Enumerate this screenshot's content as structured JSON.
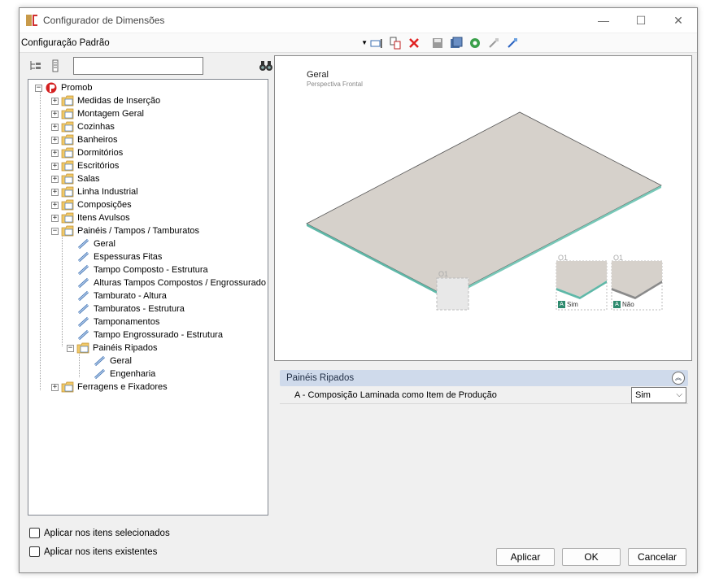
{
  "window": {
    "title": "Configurador de Dimensões",
    "minimize": "—",
    "maximize": "☐",
    "close": "✕"
  },
  "toolbar": {
    "config_value": "Configuração Padrão",
    "icons": [
      "rename-icon",
      "copy-icon",
      "delete-icon",
      "save-icon",
      "save-all-icon",
      "settings-icon",
      "import-icon",
      "export-icon"
    ]
  },
  "tree": {
    "root": "Promob",
    "items": [
      "Medidas de Inserção",
      "Montagem Geral",
      "Cozinhas",
      "Banheiros",
      "Dormitórios",
      "Escritórios",
      "Salas",
      "Linha Industrial",
      "Composições",
      "Itens Avulsos",
      "Painéis / Tampos / Tamburatos",
      "Geral",
      "Espessuras Fitas",
      "Tampo Composto - Estrutura",
      "Alturas Tampos Compostos / Engrossurado",
      "Tamburato - Altura",
      "Tamburatos - Estrutura",
      "Tamponamentos",
      "Tampo Engrossurado - Estrutura",
      "Painéis Ripados",
      "Geral",
      "Engenharia",
      "Ferragens e Fixadores"
    ]
  },
  "checks": {
    "selected": "Aplicar nos itens selecionados",
    "existing": "Aplicar nos itens existentes"
  },
  "preview": {
    "title": "Geral",
    "subtitle": "Perspectiva Frontal",
    "marker": "O1",
    "thumb1_label": "O1",
    "thumb1_badge": "A",
    "thumb1_caption": "Sim",
    "thumb2_label": "O1",
    "thumb2_badge": "A",
    "thumb2_caption": "Não"
  },
  "properties": {
    "section": "Painéis Ripados",
    "rows": [
      {
        "name": "A - Composição Laminada como Item de Produção",
        "value": "Sim"
      }
    ]
  },
  "buttons": {
    "apply": "Aplicar",
    "ok": "OK",
    "cancel": "Cancelar"
  },
  "colors": {
    "panel_top": "#d6d1cb",
    "panel_edge": "#5fb8a8",
    "header_bg": "#cfdaeb",
    "close_icon": "#e02020"
  }
}
